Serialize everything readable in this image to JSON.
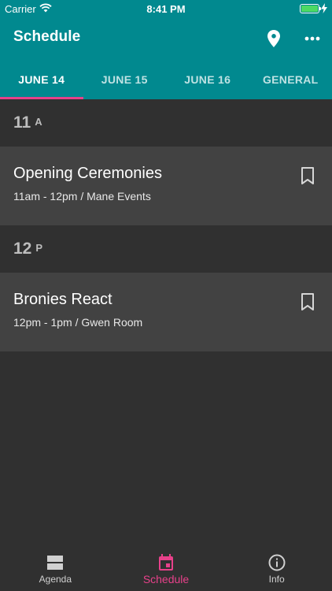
{
  "status": {
    "carrier": "Carrier",
    "time": "8:41 PM"
  },
  "app_bar": {
    "title": "Schedule",
    "icons": [
      "location-pin-icon",
      "more-horizontal-icon"
    ]
  },
  "tabs": [
    {
      "label": "JUNE 14",
      "active": true
    },
    {
      "label": "JUNE 15",
      "active": false
    },
    {
      "label": "JUNE 16",
      "active": false
    },
    {
      "label": "GENERAL",
      "active": false
    }
  ],
  "schedule": [
    {
      "hour": "11",
      "ampm": "A",
      "events": [
        {
          "title": "Opening Ceremonies",
          "subtitle": "11am - 12pm / Mane Events",
          "icon": "bookmark-icon"
        }
      ]
    },
    {
      "hour": "12",
      "ampm": "P",
      "events": [
        {
          "title": "Bronies React",
          "subtitle": "12pm - 1pm / Gwen Room",
          "icon": "bookmark-icon"
        }
      ]
    }
  ],
  "bottom_nav": [
    {
      "label": "Agenda",
      "icon": "agenda-icon",
      "active": false
    },
    {
      "label": "Schedule",
      "icon": "calendar-icon",
      "active": true
    },
    {
      "label": "Info",
      "icon": "info-icon",
      "active": false
    }
  ],
  "colors": {
    "primary": "#01898f",
    "accent": "#e7418a",
    "background": "#303030",
    "card": "#424242"
  }
}
